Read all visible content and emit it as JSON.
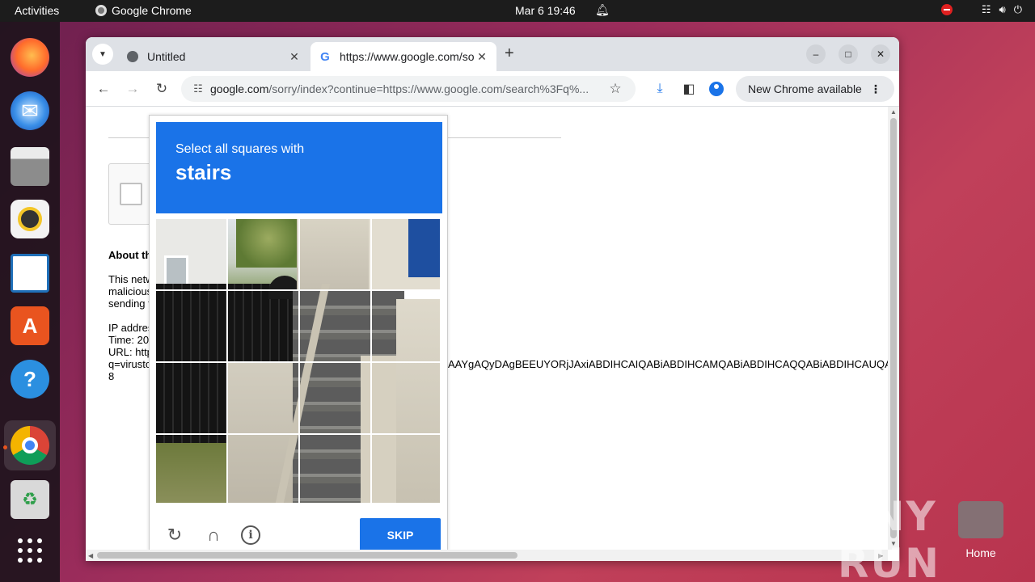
{
  "topbar": {
    "activities": "Activities",
    "app_name": "Google Chrome",
    "clock": "Mar 6  19:46"
  },
  "dock": {
    "apps": [
      "firefox",
      "thunderbird",
      "files",
      "rhythmbox",
      "libreoffice-writer",
      "app-center",
      "help",
      "google-chrome",
      "trash",
      "show-applications"
    ]
  },
  "browser": {
    "tabs": [
      {
        "title": "Untitled",
        "icon": "globe-icon"
      },
      {
        "title": "https://www.google.com/sorry/index?",
        "icon": "google-g-icon"
      }
    ],
    "address": {
      "host": "google.com",
      "path": "/sorry/index?continue=https://www.google.com/search%3Fq%..."
    },
    "update_label": "New Chrome available"
  },
  "page": {
    "about_heading": "About th",
    "para_lines": [
      "This netw",
      "malicious",
      "sending t"
    ],
    "meta_lines": [
      "IP addres",
      "Time: 20",
      "URL: http",
      "q=virusto",
      "8"
    ],
    "url_tail": "AAYgAQyDAgBEEUYORjJAxiABDIHCAIQABiABDIHCAMQABiABDIHCAQQABiABDIHCAUQA"
  },
  "captcha": {
    "instruction": "Select all squares with",
    "target": "stairs",
    "skip_label": "SKIP"
  },
  "desktop": {
    "home_label": "Home",
    "watermark": "ANY RUN"
  },
  "colors": {
    "captcha_blue": "#1a73e8",
    "accent_orange": "#e9541f"
  }
}
